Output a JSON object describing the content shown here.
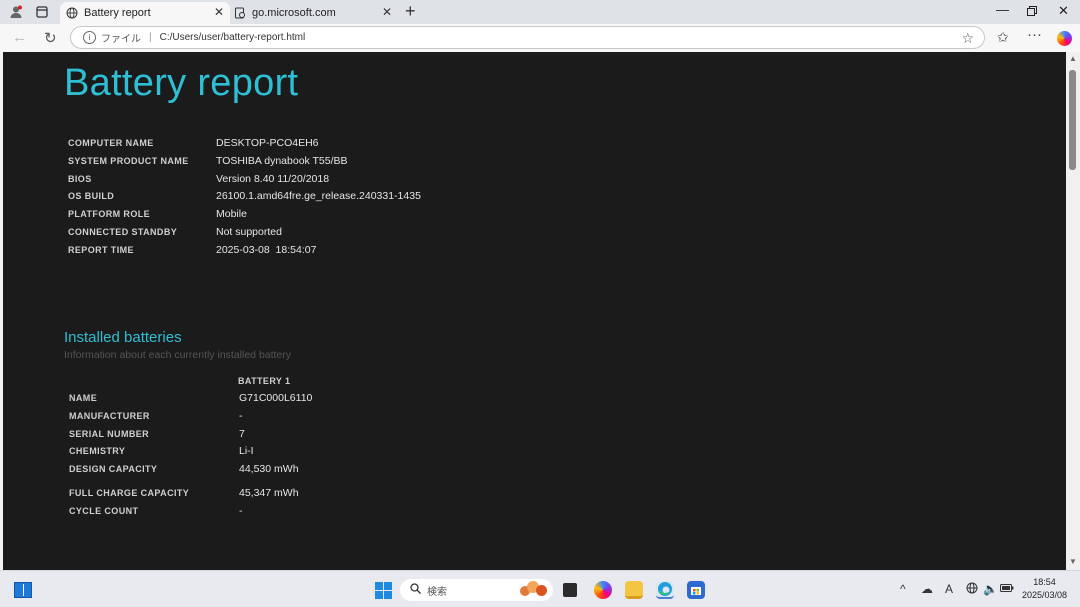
{
  "browser": {
    "tabs": [
      {
        "title": "Battery report",
        "active": true
      },
      {
        "title": "go.microsoft.com",
        "active": false
      }
    ],
    "address": {
      "protocol_label": "ファイル",
      "url": "C:/Users/user/battery-report.html"
    }
  },
  "report": {
    "title": "Battery report",
    "system_info": [
      {
        "label": "COMPUTER NAME",
        "value": "DESKTOP-PCO4EH6"
      },
      {
        "label": "SYSTEM PRODUCT NAME",
        "value": "TOSHIBA dynabook T55/BB"
      },
      {
        "label": "BIOS",
        "value": "Version 8.40 11/20/2018"
      },
      {
        "label": "OS BUILD",
        "value": "26100.1.amd64fre.ge_release.240331-1435"
      },
      {
        "label": "PLATFORM ROLE",
        "value": "Mobile"
      },
      {
        "label": "CONNECTED STANDBY",
        "value": "Not supported"
      },
      {
        "label": "REPORT TIME",
        "value": "2025-03-08  18:54:07"
      }
    ],
    "installed_batteries": {
      "title": "Installed batteries",
      "subtitle": "Information about each currently installed battery",
      "column_header": "BATTERY 1",
      "rows": [
        {
          "label": "NAME",
          "value": "G71C000L6110"
        },
        {
          "label": "MANUFACTURER",
          "value": "-"
        },
        {
          "label": "SERIAL NUMBER",
          "value": "7"
        },
        {
          "label": "CHEMISTRY",
          "value": "Li-I"
        },
        {
          "label": "DESIGN CAPACITY",
          "value": "44,530 mWh"
        },
        {
          "label": "FULL CHARGE CAPACITY",
          "value": "45,347 mWh"
        },
        {
          "label": "CYCLE COUNT",
          "value": "-"
        }
      ]
    }
  },
  "taskbar": {
    "search_placeholder": "検索",
    "clock_time": "18:54",
    "clock_date": "2025/03/08",
    "ime_indicator": "A"
  },
  "colors": {
    "accent": "#2ebfd4",
    "page_background": "#1b1b1b",
    "label_text": "#d0d0d0",
    "value_text": "#e6e6e6",
    "subtitle_text": "#555555"
  }
}
